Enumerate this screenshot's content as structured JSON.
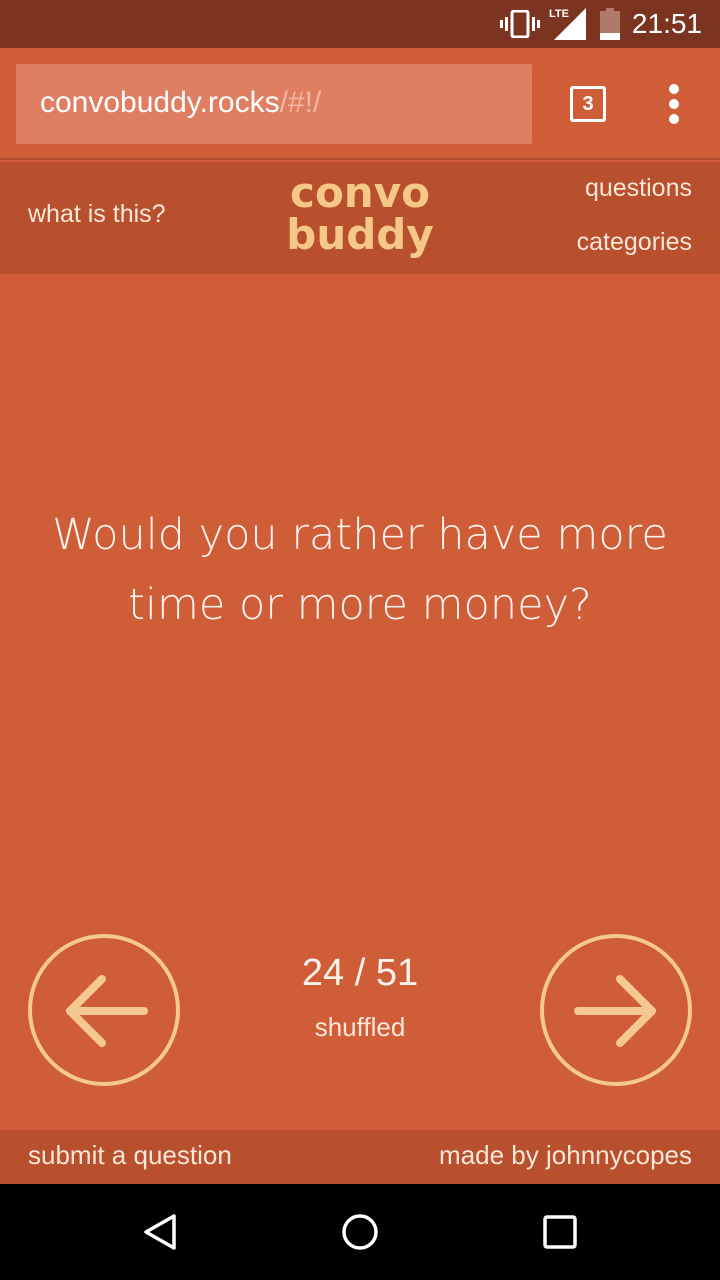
{
  "status_bar": {
    "time": "21:51",
    "network": "LTE"
  },
  "browser": {
    "url_host": "convobuddy.rocks",
    "url_path": "/#!/",
    "tab_count": "3"
  },
  "header": {
    "what_link": "what is this?",
    "logo_line1": "convo",
    "logo_line2": "buddy",
    "questions_link": "questions",
    "categories_link": "categories"
  },
  "question": {
    "text": "Would you rather have more time or more money?"
  },
  "progress": {
    "current": 24,
    "total": 51,
    "label": "24 / 51",
    "mode": "shuffled"
  },
  "footer": {
    "submit_link": "submit a question",
    "credit_link": "made by johnnycopes"
  },
  "colors": {
    "background": "#cf5d37",
    "header": "#b8502e",
    "status_bar": "#7a3420",
    "accent": "#f5c888"
  }
}
